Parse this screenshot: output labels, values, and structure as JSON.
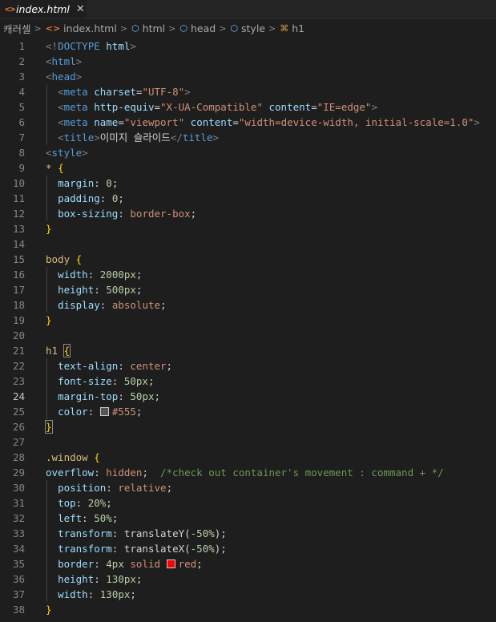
{
  "tab": {
    "filename": "index.html",
    "icon": "html-file-icon",
    "close_glyph": "✕"
  },
  "breadcrumbs": [
    {
      "label": "캐러셀",
      "icon": ""
    },
    {
      "label": "index.html",
      "icon": "html-file-icon"
    },
    {
      "label": "html",
      "icon": "element-cube-icon"
    },
    {
      "label": "head",
      "icon": "element-cube-icon"
    },
    {
      "label": "style",
      "icon": "element-cube-icon"
    },
    {
      "label": "h1",
      "icon": "css-selector-icon"
    }
  ],
  "colors": {
    "editor_bg": "#1e1e1e",
    "tag": "#569cd6",
    "attr": "#9cdcfe",
    "string": "#ce9178",
    "selector": "#d7ba7d",
    "number": "#b5cea8",
    "comment": "#6a9955",
    "bracket": "#ffd700",
    "swatch_555": "#555555",
    "swatch_red": "#ff0000"
  },
  "active_line": 24,
  "lines": [
    {
      "n": 1,
      "indent": 0,
      "tokens": [
        [
          "br",
          "<!"
        ],
        [
          "tag",
          "DOCTYPE"
        ],
        [
          "pl",
          " "
        ],
        [
          "at",
          "html"
        ],
        [
          "br",
          ">"
        ]
      ]
    },
    {
      "n": 2,
      "indent": 0,
      "tokens": [
        [
          "br",
          "<"
        ],
        [
          "tag",
          "html"
        ],
        [
          "br",
          ">"
        ]
      ]
    },
    {
      "n": 3,
      "indent": 0,
      "tokens": [
        [
          "br",
          "<"
        ],
        [
          "tag",
          "head"
        ],
        [
          "br",
          ">"
        ]
      ]
    },
    {
      "n": 4,
      "indent": 1,
      "tokens": [
        [
          "br",
          "<"
        ],
        [
          "tag",
          "meta"
        ],
        [
          "pl",
          " "
        ],
        [
          "at",
          "charset"
        ],
        [
          "pl",
          "="
        ],
        [
          "str",
          "\"UTF-8\""
        ],
        [
          "br",
          ">"
        ]
      ]
    },
    {
      "n": 5,
      "indent": 1,
      "tokens": [
        [
          "br",
          "<"
        ],
        [
          "tag",
          "meta"
        ],
        [
          "pl",
          " "
        ],
        [
          "at",
          "http-equiv"
        ],
        [
          "pl",
          "="
        ],
        [
          "str",
          "\"X-UA-Compatible\""
        ],
        [
          "pl",
          " "
        ],
        [
          "at",
          "content"
        ],
        [
          "pl",
          "="
        ],
        [
          "str",
          "\"IE=edge\""
        ],
        [
          "br",
          ">"
        ]
      ]
    },
    {
      "n": 6,
      "indent": 1,
      "tokens": [
        [
          "br",
          "<"
        ],
        [
          "tag",
          "meta"
        ],
        [
          "pl",
          " "
        ],
        [
          "at",
          "name"
        ],
        [
          "pl",
          "="
        ],
        [
          "str",
          "\"viewport\""
        ],
        [
          "pl",
          " "
        ],
        [
          "at",
          "content"
        ],
        [
          "pl",
          "="
        ],
        [
          "str",
          "\"width=device-width, initial-scale=1.0\""
        ],
        [
          "br",
          ">"
        ]
      ]
    },
    {
      "n": 7,
      "indent": 1,
      "tokens": [
        [
          "br",
          "<"
        ],
        [
          "tag",
          "title"
        ],
        [
          "br",
          ">"
        ],
        [
          "pl",
          "이미지 슬라이드"
        ],
        [
          "br",
          "</"
        ],
        [
          "tag",
          "title"
        ],
        [
          "br",
          ">"
        ]
      ]
    },
    {
      "n": 8,
      "indent": 0,
      "tokens": [
        [
          "br",
          "<"
        ],
        [
          "tag",
          "style"
        ],
        [
          "br",
          ">"
        ]
      ]
    },
    {
      "n": 9,
      "indent": 0,
      "tokens": [
        [
          "sel",
          "* "
        ],
        [
          "brk",
          "{"
        ]
      ]
    },
    {
      "n": 10,
      "indent": 1,
      "tokens": [
        [
          "pr",
          "margin"
        ],
        [
          "pl",
          ": "
        ],
        [
          "num",
          "0"
        ],
        [
          "pl",
          ";"
        ]
      ]
    },
    {
      "n": 11,
      "indent": 1,
      "tokens": [
        [
          "pr",
          "padding"
        ],
        [
          "pl",
          ": "
        ],
        [
          "num",
          "0"
        ],
        [
          "pl",
          ";"
        ]
      ]
    },
    {
      "n": 12,
      "indent": 1,
      "tokens": [
        [
          "pr",
          "box-sizing"
        ],
        [
          "pl",
          ": "
        ],
        [
          "val",
          "border-box"
        ],
        [
          "pl",
          ";"
        ]
      ]
    },
    {
      "n": 13,
      "indent": 0,
      "tokens": [
        [
          "brk",
          "}"
        ]
      ]
    },
    {
      "n": 14,
      "indent": 0,
      "tokens": []
    },
    {
      "n": 15,
      "indent": 0,
      "tokens": [
        [
          "sel",
          "body "
        ],
        [
          "brk",
          "{"
        ]
      ]
    },
    {
      "n": 16,
      "indent": 1,
      "tokens": [
        [
          "pr",
          "width"
        ],
        [
          "pl",
          ": "
        ],
        [
          "num",
          "2000px"
        ],
        [
          "pl",
          ";"
        ]
      ]
    },
    {
      "n": 17,
      "indent": 1,
      "tokens": [
        [
          "pr",
          "height"
        ],
        [
          "pl",
          ": "
        ],
        [
          "num",
          "500px"
        ],
        [
          "pl",
          ";"
        ]
      ]
    },
    {
      "n": 18,
      "indent": 1,
      "tokens": [
        [
          "pr",
          "display"
        ],
        [
          "pl",
          ": "
        ],
        [
          "val",
          "absolute"
        ],
        [
          "pl",
          ";"
        ]
      ]
    },
    {
      "n": 19,
      "indent": 0,
      "tokens": [
        [
          "brk",
          "}"
        ]
      ]
    },
    {
      "n": 20,
      "indent": 0,
      "tokens": []
    },
    {
      "n": 21,
      "indent": 0,
      "tokens": [
        [
          "sel",
          "h1 "
        ],
        [
          "brkm",
          "{"
        ]
      ]
    },
    {
      "n": 22,
      "indent": 1,
      "tokens": [
        [
          "pr",
          "text-align"
        ],
        [
          "pl",
          ": "
        ],
        [
          "val",
          "center"
        ],
        [
          "pl",
          ";"
        ]
      ]
    },
    {
      "n": 23,
      "indent": 1,
      "tokens": [
        [
          "pr",
          "font-size"
        ],
        [
          "pl",
          ": "
        ],
        [
          "num",
          "50px"
        ],
        [
          "pl",
          ";"
        ]
      ]
    },
    {
      "n": 24,
      "indent": 1,
      "tokens": [
        [
          "pr",
          "margin-top"
        ],
        [
          "pl",
          ": "
        ],
        [
          "num",
          "50px"
        ],
        [
          "pl",
          ";"
        ]
      ]
    },
    {
      "n": 25,
      "indent": 1,
      "tokens": [
        [
          "pr",
          "color"
        ],
        [
          "pl",
          ": "
        ],
        [
          "swatch",
          "#555555"
        ],
        [
          "val",
          "#555"
        ],
        [
          "pl",
          ";"
        ]
      ]
    },
    {
      "n": 26,
      "indent": 0,
      "tokens": [
        [
          "brkm",
          "}"
        ]
      ]
    },
    {
      "n": 27,
      "indent": 0,
      "tokens": []
    },
    {
      "n": 28,
      "indent": 0,
      "tokens": [
        [
          "sel",
          ".window "
        ],
        [
          "brk",
          "{"
        ]
      ]
    },
    {
      "n": 29,
      "indent": 0,
      "tokens": [
        [
          "pr",
          "overflow"
        ],
        [
          "pl",
          ": "
        ],
        [
          "val",
          "hidden"
        ],
        [
          "pl",
          ";  "
        ],
        [
          "cm",
          "/*check out container's movement : command + */"
        ]
      ]
    },
    {
      "n": 30,
      "indent": 1,
      "tokens": [
        [
          "pr",
          "position"
        ],
        [
          "pl",
          ": "
        ],
        [
          "val",
          "relative"
        ],
        [
          "pl",
          ";"
        ]
      ]
    },
    {
      "n": 31,
      "indent": 1,
      "tokens": [
        [
          "pr",
          "top"
        ],
        [
          "pl",
          ": "
        ],
        [
          "num",
          "20%"
        ],
        [
          "pl",
          ";"
        ]
      ]
    },
    {
      "n": 32,
      "indent": 1,
      "tokens": [
        [
          "pr",
          "left"
        ],
        [
          "pl",
          ": "
        ],
        [
          "num",
          "50%"
        ],
        [
          "pl",
          ";"
        ]
      ]
    },
    {
      "n": 33,
      "indent": 1,
      "tokens": [
        [
          "pr",
          "transform"
        ],
        [
          "pl",
          ": "
        ],
        [
          "pl",
          "translateY("
        ],
        [
          "num",
          "-50%"
        ],
        [
          "pl",
          ");"
        ]
      ]
    },
    {
      "n": 34,
      "indent": 1,
      "tokens": [
        [
          "pr",
          "transform"
        ],
        [
          "pl",
          ": "
        ],
        [
          "pl",
          "translateX("
        ],
        [
          "num",
          "-50%"
        ],
        [
          "pl",
          ");"
        ]
      ]
    },
    {
      "n": 35,
      "indent": 1,
      "tokens": [
        [
          "pr",
          "border"
        ],
        [
          "pl",
          ": "
        ],
        [
          "num",
          "4px"
        ],
        [
          "pl",
          " "
        ],
        [
          "val",
          "solid"
        ],
        [
          "pl",
          " "
        ],
        [
          "swatch",
          "#ff0000"
        ],
        [
          "val",
          "red"
        ],
        [
          "pl",
          ";"
        ]
      ]
    },
    {
      "n": 36,
      "indent": 1,
      "tokens": [
        [
          "pr",
          "height"
        ],
        [
          "pl",
          ": "
        ],
        [
          "num",
          "130px"
        ],
        [
          "pl",
          ";"
        ]
      ]
    },
    {
      "n": 37,
      "indent": 1,
      "tokens": [
        [
          "pr",
          "width"
        ],
        [
          "pl",
          ": "
        ],
        [
          "num",
          "130px"
        ],
        [
          "pl",
          ";"
        ]
      ]
    },
    {
      "n": 38,
      "indent": 0,
      "tokens": [
        [
          "brk",
          "}"
        ]
      ]
    }
  ]
}
